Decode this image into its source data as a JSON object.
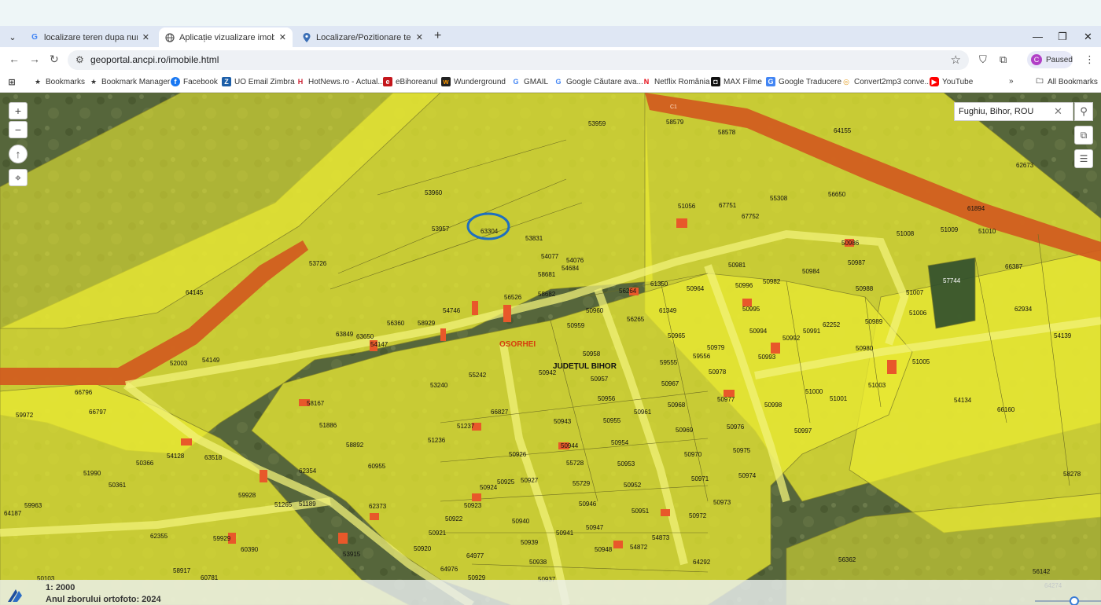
{
  "browser": {
    "tabs": [
      {
        "title": "localizare teren dupa numar ca",
        "favicon": "G",
        "active": false
      },
      {
        "title": "Aplicație vizualizare imobile",
        "favicon": "globe",
        "active": true
      },
      {
        "title": "Localizare/Pozitionare teren - f",
        "favicon": "pin",
        "active": false
      }
    ],
    "url": "geoportal.ancpi.ro/imobile.html",
    "profile_label": "Paused",
    "profile_initial": "C"
  },
  "bookmarks": [
    {
      "label": "Bookmarks",
      "icon": "star-icon"
    },
    {
      "label": "Bookmark Manager",
      "icon": "star-icon"
    },
    {
      "label": "Facebook",
      "icon": "facebook-icon"
    },
    {
      "label": "UO Email Zimbra",
      "icon": "zimbra-icon"
    },
    {
      "label": "HotNews.ro - Actual...",
      "icon": "hotnews-icon"
    },
    {
      "label": "eBihoreanul",
      "icon": "ebihoreanul-icon"
    },
    {
      "label": "Wunderground",
      "icon": "wunderground-icon"
    },
    {
      "label": "GMAIL",
      "icon": "google-icon"
    },
    {
      "label": "Google Căutare ava...",
      "icon": "google-icon"
    },
    {
      "label": "Netflix România",
      "icon": "netflix-icon"
    },
    {
      "label": "MAX Filme",
      "icon": "max-icon"
    },
    {
      "label": "Google Traducere",
      "icon": "translate-icon"
    },
    {
      "label": "Convert2mp3 conve...",
      "icon": "convert-icon"
    },
    {
      "label": "YouTube",
      "icon": "youtube-icon"
    }
  ],
  "all_bookmarks_label": "All Bookmarks",
  "map": {
    "search_value": "Fughiu, Bihor, ROU",
    "scale": "1: 2000",
    "ortho_year": "Anul zborului ortofoto: 2024",
    "place_label": "OSORHEI",
    "county_label": "JUDEȚUL BIHOR",
    "road_label": "C1",
    "highlighted_parcel": "63304",
    "parcel_labels": [
      "53959",
      "58579",
      "58578",
      "64155",
      "62673",
      "53960",
      "53957",
      "63304",
      "53831",
      "54077",
      "54076",
      "58681",
      "54684",
      "53726",
      "51056",
      "67751",
      "67752",
      "55308",
      "56650",
      "61894",
      "51008",
      "51009",
      "51010",
      "50986",
      "50987",
      "66387",
      "64145",
      "58682",
      "56526",
      "54746",
      "56360",
      "58929",
      "61350",
      "56264",
      "50981",
      "50982",
      "50984",
      "50964",
      "50996",
      "50995",
      "50988",
      "57744",
      "51007",
      "51006",
      "62934",
      "50960",
      "50959",
      "56265",
      "61349",
      "50965",
      "62252",
      "50989",
      "50991",
      "50994",
      "50992",
      "50980",
      "54139",
      "63849",
      "63650",
      "54147",
      "50958",
      "50979",
      "59556",
      "59555",
      "50978",
      "50993",
      "51005",
      "52003",
      "54149",
      "50942",
      "50957",
      "55242",
      "53240",
      "50967",
      "50968",
      "50977",
      "51000",
      "51001",
      "51003",
      "54134",
      "66160",
      "66796",
      "66797",
      "59972",
      "58167",
      "50956",
      "50961",
      "50969",
      "50976",
      "50998",
      "50997",
      "51886",
      "66827",
      "51237",
      "50943",
      "50955",
      "50944",
      "50954",
      "50970",
      "50975",
      "54128",
      "63518",
      "50366",
      "51236",
      "58892",
      "60955",
      "50926",
      "55728",
      "50953",
      "50974",
      "58278",
      "51990",
      "50361",
      "62354",
      "50925",
      "50927",
      "55729",
      "50971",
      "50952",
      "59928",
      "51265",
      "51189",
      "50924",
      "50946",
      "50973",
      "64187",
      "59963",
      "62373",
      "50923",
      "50922",
      "50940",
      "50947",
      "50951",
      "50972",
      "62355",
      "59929",
      "60390",
      "50921",
      "50939",
      "50941",
      "54873",
      "50948",
      "54872",
      "53915",
      "50920",
      "64977",
      "50938",
      "64292",
      "56362",
      "58917",
      "60781",
      "64976",
      "50929",
      "50937",
      "56142",
      "50103",
      "64274"
    ]
  },
  "colors": {
    "parcel_fill": "#e8e833",
    "road_fill": "#d2581e",
    "highlight_ring": "#1f6fbf"
  }
}
